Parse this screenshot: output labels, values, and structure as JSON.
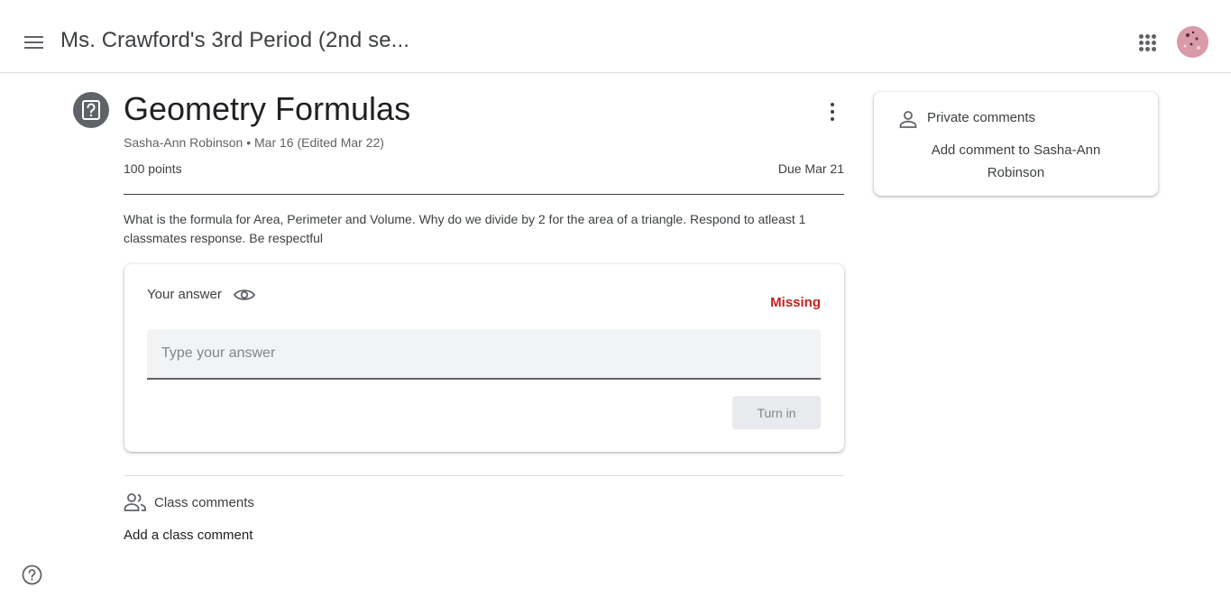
{
  "header": {
    "class_name": "Ms. Crawford's 3rd Period (2nd se...",
    "menu_icon": "hamburger-menu-icon",
    "apps_icon": "google-apps-icon",
    "avatar_icon": "user-avatar"
  },
  "assignment": {
    "icon": "question-assignment-icon",
    "title": "Geometry Formulas",
    "meta": "Sasha-Ann Robinson • Mar 16 (Edited Mar 22)",
    "points": "100 points",
    "due": "Due Mar 21",
    "description": "What is the formula for Area, Perimeter and Volume. Why do we divide by 2 for the area of a triangle. Respond to atleast 1 classmates response. Be respectful"
  },
  "answer": {
    "label": "Your answer",
    "visibility_icon": "eye-icon",
    "status": "Missing",
    "placeholder": "Type your answer",
    "value": "",
    "turn_in_label": "Turn in"
  },
  "class_comments": {
    "icon": "people-icon",
    "title": "Class comments",
    "add_label": "Add a class comment"
  },
  "private_comments": {
    "icon": "person-icon",
    "title": "Private comments",
    "add_label": "Add comment to Sasha-Ann Robinson"
  },
  "footer": {
    "help_icon": "help-icon"
  },
  "colors": {
    "missing": "#c5221f",
    "assignment_icon_bg": "#5f6368",
    "avatar_bg": "#d79aa8",
    "divider": "#dadce0"
  }
}
